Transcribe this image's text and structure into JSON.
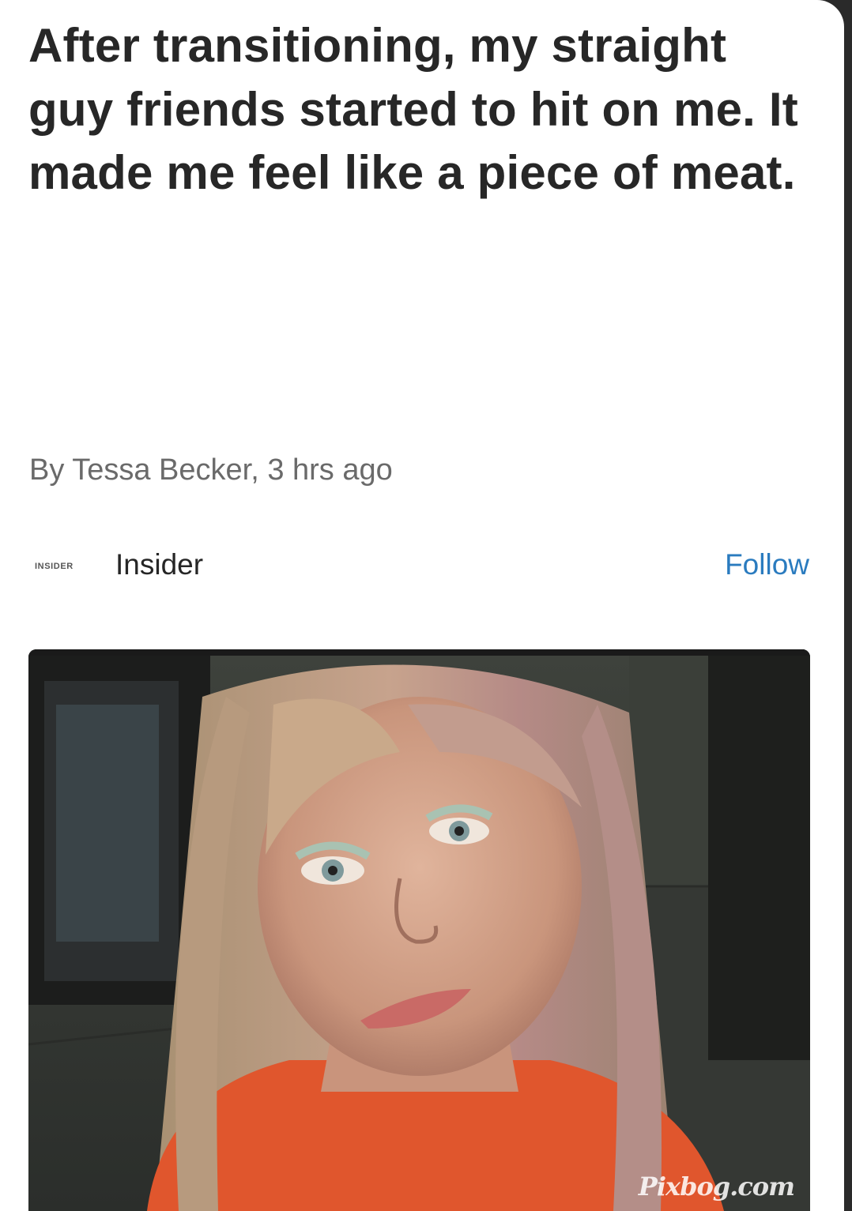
{
  "article": {
    "headline": "After transitioning, my straight guy friends started to hit on me. It made me feel like a piece of meat.",
    "byline": "By Tessa Becker, 3 hrs ago"
  },
  "publisher": {
    "logo_text": "INSIDER",
    "name": "Insider",
    "follow_label": "Follow"
  },
  "photo": {
    "watermark": "Pixbog.com"
  },
  "colors": {
    "follow_link": "#2a7bbf",
    "headline_text": "#272727",
    "byline_text": "#6a6a6a"
  }
}
